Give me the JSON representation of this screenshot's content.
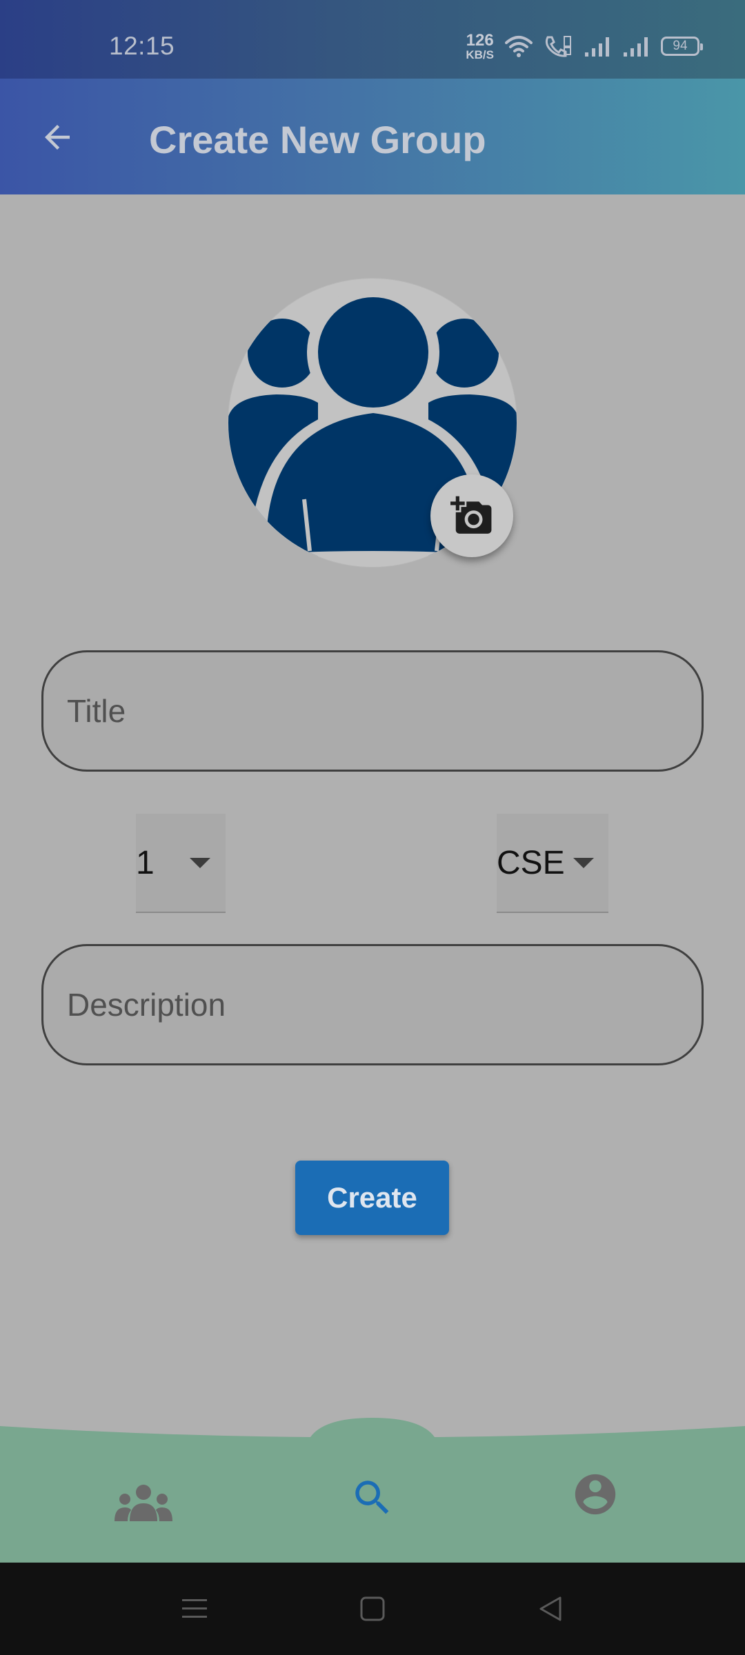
{
  "status_bar": {
    "time": "12:15",
    "net_speed_value": "126",
    "net_speed_unit": "KB/S",
    "battery": "94",
    "icons": [
      "wifi-icon",
      "volte-call-icon",
      "signal-1-icon",
      "signal-2-icon",
      "battery-icon"
    ]
  },
  "app_bar": {
    "title": "Create New Group",
    "back_icon": "arrow-back-icon"
  },
  "avatar": {
    "icon": "group-icon",
    "camera_icon": "add-a-photo-icon"
  },
  "form": {
    "title_placeholder": "Title",
    "title_value": "",
    "year_value": "1",
    "department_value": "CSE",
    "description_placeholder": "Description",
    "description_value": "",
    "create_label": "Create"
  },
  "bottom_nav": {
    "items": [
      {
        "icon": "groups-icon",
        "active": false
      },
      {
        "icon": "search-icon",
        "active": true
      },
      {
        "icon": "account-circle-icon",
        "active": false
      }
    ]
  },
  "colors": {
    "app_bar_start": "#3b55a6",
    "app_bar_end": "#4a96a8",
    "primary": "#1b6db5",
    "avatar_icon": "#003566",
    "bottom_nav_bg": "#79a78f",
    "page_bg": "#b0b0b0"
  }
}
